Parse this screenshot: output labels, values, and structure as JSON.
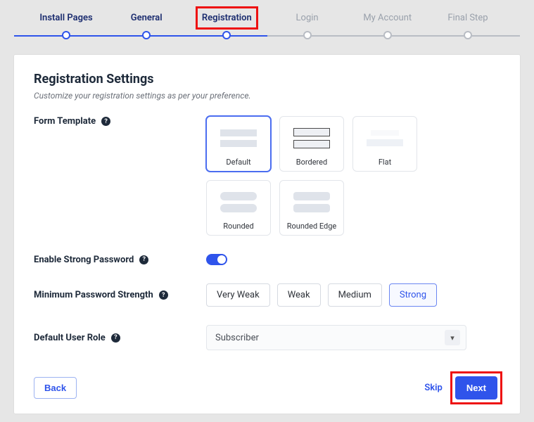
{
  "stepper": {
    "items": [
      {
        "label": "Install Pages",
        "state": "done"
      },
      {
        "label": "General",
        "state": "done"
      },
      {
        "label": "Registration",
        "state": "active"
      },
      {
        "label": "Login",
        "state": "todo"
      },
      {
        "label": "My Account",
        "state": "todo"
      },
      {
        "label": "Final Step",
        "state": "todo"
      }
    ]
  },
  "page": {
    "title": "Registration Settings",
    "subtitle": "Customize your registration settings as per your preference."
  },
  "form_template": {
    "label": "Form Template",
    "options": [
      "Default",
      "Bordered",
      "Flat",
      "Rounded",
      "Rounded Edge"
    ],
    "selected": "Default"
  },
  "strong_password": {
    "label": "Enable Strong Password",
    "value": true
  },
  "min_strength": {
    "label": "Minimum Password Strength",
    "options": [
      "Very Weak",
      "Weak",
      "Medium",
      "Strong"
    ],
    "selected": "Strong"
  },
  "default_role": {
    "label": "Default User Role",
    "value": "Subscriber"
  },
  "footer": {
    "back": "Back",
    "skip": "Skip",
    "next": "Next"
  }
}
